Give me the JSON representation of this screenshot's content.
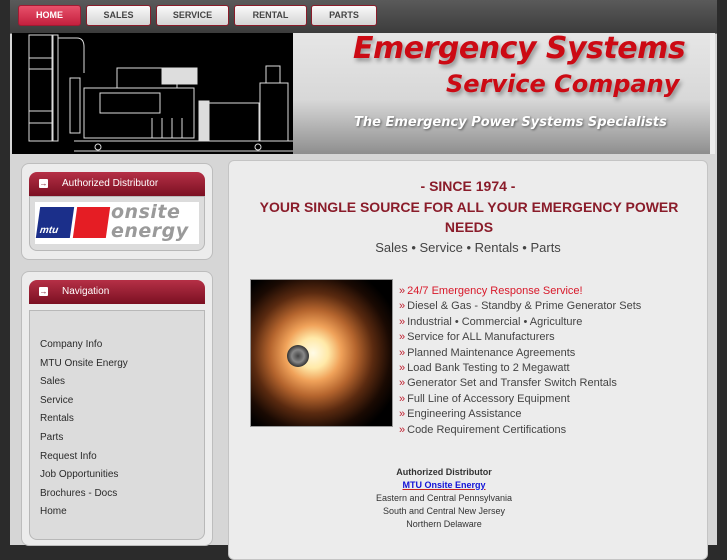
{
  "top_nav": {
    "tabs": [
      {
        "label": "HOME",
        "active": true
      },
      {
        "label": "SALES",
        "active": false
      },
      {
        "label": "SERVICE",
        "active": false
      },
      {
        "label": "RENTAL",
        "active": false
      },
      {
        "label": "PARTS",
        "active": false
      }
    ]
  },
  "banner": {
    "brand_line1": "Emergency Systems",
    "brand_line2": "Service Company",
    "tagline": "The Emergency Power  Systems Specialists",
    "image": "generator-line-drawing"
  },
  "sidebar": {
    "distributor_box": {
      "header": "Authorized Distributor",
      "header_icon": "arrow-right-box-icon",
      "logo": {
        "mark": "mtu",
        "text_line1": "onsite",
        "text_line2": "energy"
      }
    },
    "navigation_box": {
      "header": "Navigation",
      "header_icon": "arrow-right-box-icon",
      "items": [
        "Company Info",
        "MTU Onsite Energy",
        "Sales",
        "Service",
        "Rentals",
        "Parts",
        "Request Info",
        "Job Opportunities",
        "Brochures - Docs",
        "Home"
      ]
    }
  },
  "main": {
    "since": "- SINCE 1974 -",
    "headline": "YOUR SINGLE SOURCE FOR ALL YOUR EMERGENCY POWER NEEDS",
    "services_line": "Sales • Service • Rentals • Parts",
    "image": "hands-holding-glowing-light-bulb",
    "bullet_glyph": "»",
    "features": [
      "24/7 Emergency Response Service!",
      "Diesel & Gas - Standby & Prime Generator Sets",
      "Industrial • Commercial • Agriculture",
      "Service for ALL Manufacturers",
      "Planned Maintenance Agreements",
      "Load Bank Testing to 2 Megawatt",
      "Generator Set and Transfer Switch Rentals",
      "Full Line of Accessory Equipment",
      "Engineering Assistance",
      "Code Requirement Certifications"
    ],
    "distributor": {
      "title": "Authorized Distributor",
      "link": "MTU Onsite Energy",
      "regions": [
        "Eastern and Central Pennsylvania",
        "South and Central New Jersey",
        "Northern Delaware"
      ]
    }
  },
  "colors": {
    "accent_red": "#8a1c2a",
    "brand_red": "#cc0a14",
    "highlight_red": "#d8192a",
    "link_blue": "#1212d8"
  }
}
